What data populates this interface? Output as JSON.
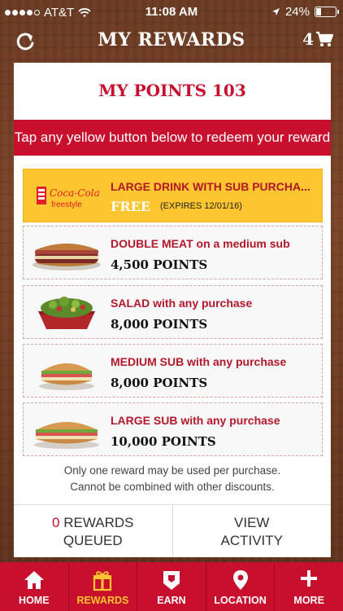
{
  "status_bar": {
    "carrier": "AT&T",
    "time": "11:08 AM",
    "battery": "24%",
    "battery_level": 0.24
  },
  "nav": {
    "title": "MY REWARDS",
    "cart_count": "4"
  },
  "points_title": "MY POINTS 103",
  "banner": "Tap any yellow button below to redeem your reward",
  "rewards": [
    {
      "title": "LARGE DRINK WITH SUB PURCHA...",
      "free": "FREE",
      "expires": "(EXPIRES 12/01/16)",
      "icon": "coca-cola-freestyle-logo",
      "logo_text": "Coca-Cola",
      "logo_sub": "freestyle",
      "active": true
    },
    {
      "title": "DOUBLE MEAT on a medium sub",
      "points": "4,500 POINTS",
      "icon": "sub-sandwich-icon"
    },
    {
      "title": "SALAD with any purchase",
      "points": "8,000 POINTS",
      "icon": "salad-icon"
    },
    {
      "title": "MEDIUM SUB with any purchase",
      "points": "8,000 POINTS",
      "icon": "sub-sandwich-icon"
    },
    {
      "title": "LARGE SUB with any purchase",
      "points": "10,000 POINTS",
      "icon": "sub-sandwich-icon"
    }
  ],
  "disclaimer": {
    "line1": "Only one reward may be used per purchase.",
    "line2": "Cannot be combined with other discounts."
  },
  "queued": {
    "count": "0",
    "label_line1": "REWARDS",
    "label_line2": "QUEUED"
  },
  "view_activity": {
    "line1": "VIEW",
    "line2": "ACTIVITY"
  },
  "tabs": [
    {
      "label": "HOME",
      "icon": "home-icon"
    },
    {
      "label": "REWARDS",
      "icon": "gift-icon",
      "active": true
    },
    {
      "label": "EARN",
      "icon": "badge-icon"
    },
    {
      "label": "LOCATION",
      "icon": "location-pin-icon"
    },
    {
      "label": "MORE",
      "icon": "plus-icon"
    }
  ],
  "colors": {
    "brand_red": "#c8102e",
    "reward_yellow": "#fdc52f",
    "wood": "#6b3a20"
  }
}
